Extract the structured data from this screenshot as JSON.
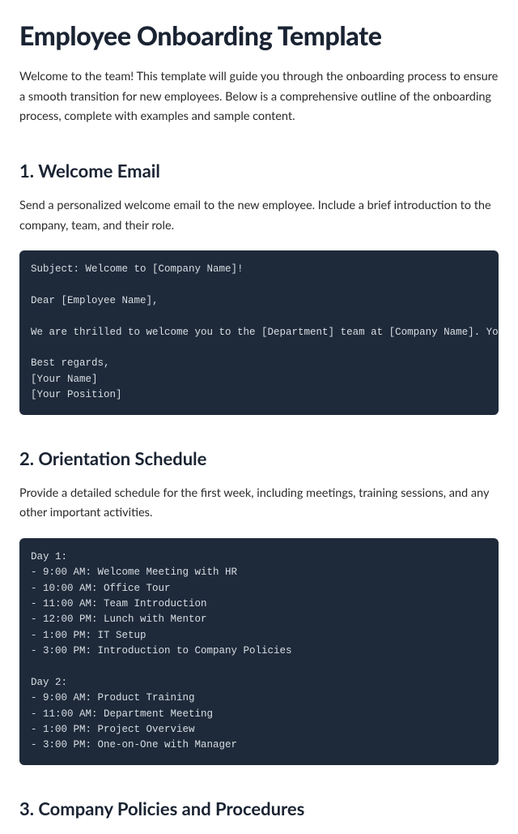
{
  "title": "Employee Onboarding Template",
  "intro": "Welcome to the team! This template will guide you through the onboarding process to ensure a smooth transition for new employees. Below is a comprehensive outline of the onboarding process, complete with examples and sample content.",
  "section1": {
    "heading": "1. Welcome Email",
    "desc": "Send a personalized welcome email to the new employee. Include a brief introduction to the company, team, and their role.",
    "code": "Subject: Welcome to [Company Name]!\n\nDear [Employee Name],\n\nWe are thrilled to welcome you to the [Department] team at [Company Name]. Your skills\n\nBest regards,\n[Your Name]\n[Your Position]"
  },
  "section2": {
    "heading": "2. Orientation Schedule",
    "desc": "Provide a detailed schedule for the first week, including meetings, training sessions, and any other important activities.",
    "code": "Day 1:\n- 9:00 AM: Welcome Meeting with HR\n- 10:00 AM: Office Tour\n- 11:00 AM: Team Introduction\n- 12:00 PM: Lunch with Mentor\n- 1:00 PM: IT Setup\n- 3:00 PM: Introduction to Company Policies\n\nDay 2:\n- 9:00 AM: Product Training\n- 11:00 AM: Department Meeting\n- 1:00 PM: Project Overview\n- 3:00 PM: One-on-One with Manager"
  },
  "section3": {
    "heading": "3. Company Policies and Procedures"
  }
}
